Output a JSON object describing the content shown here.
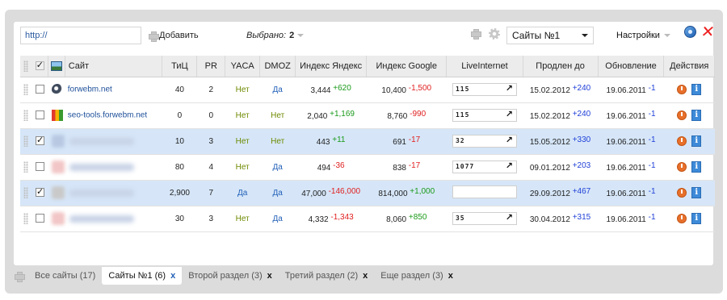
{
  "toolbar": {
    "url_value": "http://",
    "add_label": "Добавить",
    "selected_label": "Выбрано:",
    "selected_count": "2",
    "project_select": "Сайты №1",
    "settings_label": "Настройки"
  },
  "table": {
    "headers": {
      "site": "Сайт",
      "tic": "ТиЦ",
      "pr": "PR",
      "yaca": "YACA",
      "dmoz": "DMOZ",
      "yandex_index": "Индекс Яндекс",
      "google_index": "Индекс Google",
      "liveinternet": "LiveInternet",
      "renewed": "Продлен до",
      "updated": "Обновление",
      "actions": "Действия"
    },
    "rows": [
      {
        "checked": false,
        "site": "forwebm.net",
        "tic": "40",
        "pr": "2",
        "yaca": "Нет",
        "dmoz": "Да",
        "yandex": "3,444",
        "yandex_delta": "+620",
        "google": "10,400",
        "google_delta": "-1,500",
        "li": "115",
        "renewed": "15.02.2012",
        "renewed_delta": "+240",
        "updated": "19.06.2011",
        "updated_delta": "-1"
      },
      {
        "checked": false,
        "site": "seo-tools.forwebm.net",
        "tic": "0",
        "pr": "0",
        "yaca": "Нет",
        "dmoz": "Нет",
        "yandex": "2,040",
        "yandex_delta": "+1,169",
        "google": "8,760",
        "google_delta": "-990",
        "li": "115",
        "renewed": "15.02.2012",
        "renewed_delta": "+240",
        "updated": "19.06.2011",
        "updated_delta": "-1"
      },
      {
        "checked": true,
        "site": "",
        "tic": "10",
        "pr": "3",
        "yaca": "Нет",
        "dmoz": "Нет",
        "yandex": "443",
        "yandex_delta": "+11",
        "google": "691",
        "google_delta": "-17",
        "li": "32",
        "renewed": "15.05.2012",
        "renewed_delta": "+330",
        "updated": "19.06.2011",
        "updated_delta": "-1"
      },
      {
        "checked": false,
        "site": "",
        "tic": "80",
        "pr": "4",
        "yaca": "Нет",
        "dmoz": "Да",
        "yandex": "494",
        "yandex_delta": "-36",
        "google": "838",
        "google_delta": "-17",
        "li": "1077",
        "renewed": "09.01.2012",
        "renewed_delta": "+203",
        "updated": "19.06.2011",
        "updated_delta": "-1"
      },
      {
        "checked": true,
        "site": "",
        "tic": "2,900",
        "pr": "7",
        "yaca": "Да",
        "dmoz": "Да",
        "yandex": "47,000",
        "yandex_delta": "-146,000",
        "google": "814,000",
        "google_delta": "+1,000",
        "li": "",
        "renewed": "29.09.2012",
        "renewed_delta": "+467",
        "updated": "19.06.2011",
        "updated_delta": "-1"
      },
      {
        "checked": false,
        "site": "",
        "tic": "30",
        "pr": "3",
        "yaca": "Нет",
        "dmoz": "Да",
        "yandex": "4,332",
        "yandex_delta": "-1,343",
        "google": "8,060",
        "google_delta": "+850",
        "li": "35",
        "renewed": "30.04.2012",
        "renewed_delta": "+315",
        "updated": "19.06.2011",
        "updated_delta": "-1"
      }
    ]
  },
  "tabs": [
    {
      "label": "Все сайты (17)",
      "close": ""
    },
    {
      "label": "Сайты №1 (6)",
      "close": "x"
    },
    {
      "label": "Второй раздел (3)",
      "close": "x"
    },
    {
      "label": "Третий раздел (2)",
      "close": "x"
    },
    {
      "label": "Еще раздел (3)",
      "close": "x"
    }
  ],
  "icons": {
    "info_glyph": "i",
    "li_arrow": "↗",
    "close_glyph": "✕"
  },
  "colors": {
    "accent_blue": "#1d4f9a",
    "highlight_row": "#d6e6f8",
    "positive": "#1a9a1a",
    "negative": "#e02020",
    "no_value": "#6d8a00"
  }
}
